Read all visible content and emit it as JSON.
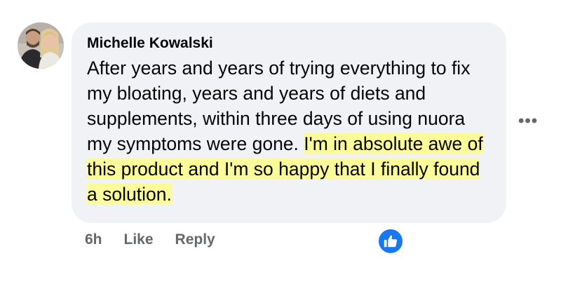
{
  "comment": {
    "author": "Michelle Kowalski",
    "text_plain": "After years and years of trying everything to fix my bloating, years and years of diets and supplements, within three days of using nuora my symptoms were gone. ",
    "text_highlighted": "I'm in absolute awe of this product and I'm so happy that I finally found a solution.",
    "highlight_color": "#fbfb9a",
    "bubble_color": "#f0f2f5"
  },
  "actions": {
    "time": "6h",
    "like_label": "Like",
    "reply_label": "Reply"
  },
  "icons": {
    "more": "more-options-icon",
    "reaction": "thumbs-up-reaction-icon",
    "reaction_color": "#1877f2"
  },
  "more_label": "•••"
}
